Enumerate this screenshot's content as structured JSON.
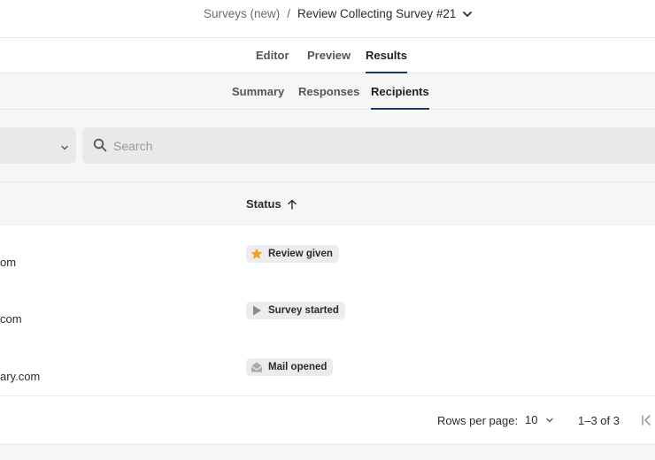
{
  "breadcrumb": {
    "parent": "Surveys (new)",
    "separator": "/",
    "current": "Review Collecting Survey #21",
    "chevron_icon": "chevron-down-icon"
  },
  "main_tabs": [
    {
      "label": "Editor",
      "active": false
    },
    {
      "label": "Preview",
      "active": false
    },
    {
      "label": "Results",
      "active": true
    }
  ],
  "sub_tabs": [
    {
      "label": "Summary",
      "active": false
    },
    {
      "label": "Responses",
      "active": false
    },
    {
      "label": "Recipients",
      "active": true
    }
  ],
  "filter": {
    "dropdown_value": "",
    "search_placeholder": "Search",
    "search_value": ""
  },
  "table": {
    "columns": [
      {
        "label": "Status",
        "sort": "ascending",
        "sort_icon": "arrow-up-icon"
      }
    ],
    "rows": [
      {
        "email": "om",
        "status": "Review given",
        "status_icon": "star-icon"
      },
      {
        "email": "com",
        "status": "Survey started",
        "status_icon": "play-icon"
      },
      {
        "email": "ary.com",
        "status": "Mail opened",
        "status_icon": "envelope-open-icon"
      }
    ]
  },
  "pagination": {
    "rows_per_page_label": "Rows per page:",
    "rows_per_page_value": "10",
    "range": "1–3 of 3",
    "first_page_icon": "first-page-icon"
  },
  "colors": {
    "active_underline": "#1f3a68",
    "star": "#f0a323",
    "badge_bg": "#ececec",
    "panel_bg": "#f6f6f6"
  }
}
